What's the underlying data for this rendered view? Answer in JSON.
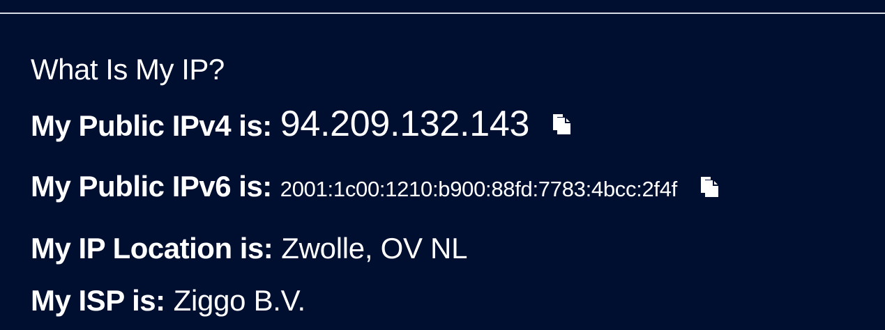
{
  "page": {
    "heading": "What Is My IP?"
  },
  "ipv4": {
    "label": "My Public IPv4 is:",
    "value": "94.209.132.143",
    "copy_icon": "copy-icon"
  },
  "ipv6": {
    "label": "My Public IPv6 is:",
    "value": "2001:1c00:1210:b900:88fd:7783:4bcc:2f4f",
    "copy_icon": "copy-icon"
  },
  "location": {
    "label": "My IP Location is:",
    "value": "Zwolle, OV NL"
  },
  "isp": {
    "label": "My ISP is:",
    "value": "Ziggo B.V."
  },
  "colors": {
    "background": "#000f30",
    "text": "#ffffff",
    "rule": "#d9dde6"
  }
}
